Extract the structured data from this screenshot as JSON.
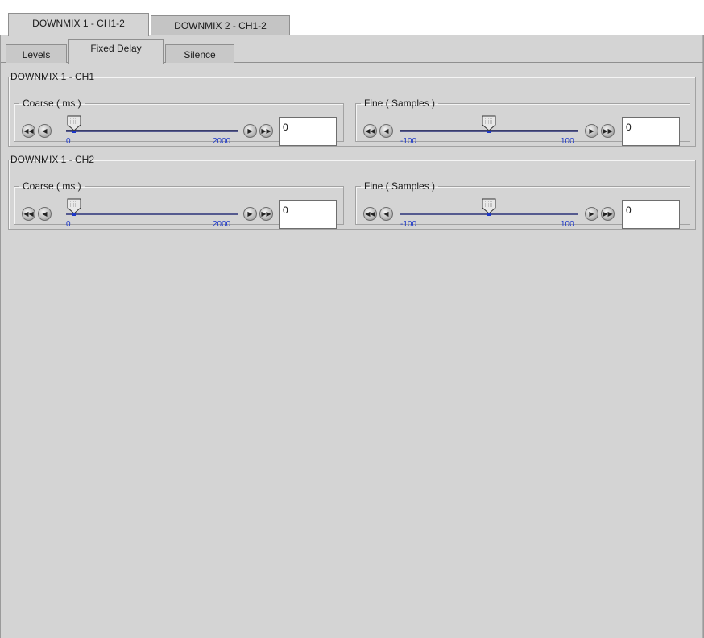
{
  "top_tabs": [
    {
      "label": "DOWNMIX 1 - CH1-2",
      "active": true
    },
    {
      "label": "DOWNMIX 2 - CH1-2",
      "active": false
    }
  ],
  "sub_tabs": [
    {
      "label": "Levels",
      "active": false
    },
    {
      "label": "Fixed Delay",
      "active": true
    },
    {
      "label": "Silence",
      "active": false
    }
  ],
  "groups": [
    {
      "title": "DOWNMIX 1 - CH1",
      "coarse": {
        "title": "Coarse ( ms )",
        "min": "0",
        "max": "2000",
        "value": "0"
      },
      "fine": {
        "title": "Fine ( Samples )",
        "min": "-100",
        "max": "100",
        "value": "0"
      }
    },
    {
      "title": "DOWNMIX 1 - CH2",
      "coarse": {
        "title": "Coarse ( ms )",
        "min": "0",
        "max": "2000",
        "value": "0"
      },
      "fine": {
        "title": "Fine ( Samples )",
        "min": "-100",
        "max": "100",
        "value": "0"
      }
    }
  ],
  "icons": {
    "fast_rewind": "fast-rewind-icon",
    "step_back": "step-back-icon",
    "step_forward": "step-forward-icon",
    "fast_forward": "fast-forward-icon"
  },
  "colors": {
    "panel_bg": "#d4d4d4",
    "track": "#555a8f",
    "tick_label": "#1c37c8"
  }
}
